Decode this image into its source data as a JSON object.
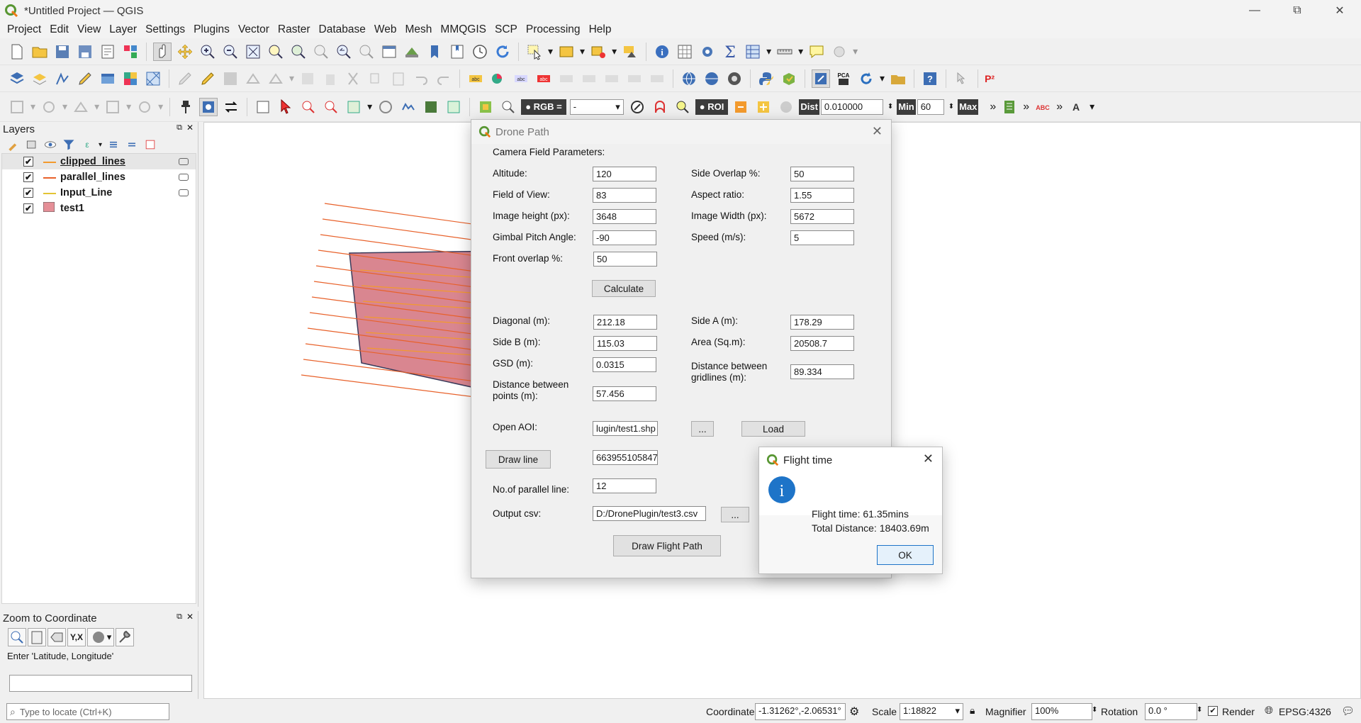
{
  "window": {
    "title": "*Untitled Project — QGIS"
  },
  "menu": [
    "Project",
    "Edit",
    "View",
    "Layer",
    "Settings",
    "Plugins",
    "Vector",
    "Raster",
    "Database",
    "Web",
    "Mesh",
    "MMQGIS",
    "SCP",
    "Processing",
    "Help"
  ],
  "toolbar3": {
    "rgb_label": "RGB =",
    "rgb_value": "-",
    "roi_label": "ROI",
    "dist_label": "Dist",
    "dist_value": "0.010000",
    "min_label": "Min",
    "min_value": "60",
    "max_label": "Max",
    "more": "»",
    "p2": "P²"
  },
  "layers_panel": {
    "title": "Layers",
    "layers": [
      {
        "name": "clipped_lines",
        "checked": true,
        "color": "#f39a2d"
      },
      {
        "name": "parallel_lines",
        "checked": true,
        "color": "#e8612a"
      },
      {
        "name": "Input_Line",
        "checked": true,
        "color": "#e3c434"
      },
      {
        "name": "test1",
        "checked": true,
        "color": "#e58f97"
      }
    ]
  },
  "zoom_panel": {
    "title": "Zoom to Coordinate",
    "prompt": "Enter 'Latitude, Longitude'",
    "input_value": "",
    "yx_label": "Y,X"
  },
  "status": {
    "locate_placeholder": "Type to locate (Ctrl+K)",
    "coordinate_label": "Coordinate",
    "coordinate_value": "-1.31262°,-2.06531°",
    "scale_label": "Scale",
    "scale_value": "1:18822",
    "magnifier_label": "Magnifier",
    "magnifier_value": "100%",
    "rotation_label": "Rotation",
    "rotation_value": "0.0 °",
    "render_label": "Render",
    "crs": "EPSG:4326"
  },
  "drone_dialog": {
    "title": "Drone Path",
    "section": "Camera Field Parameters:",
    "fields": {
      "altitude": {
        "label": "Altitude:",
        "value": "120"
      },
      "side_overlap": {
        "label": "Side Overlap %:",
        "value": "50"
      },
      "fov": {
        "label": "Field of View:",
        "value": "83"
      },
      "aspect": {
        "label": "Aspect ratio:",
        "value": "1.55"
      },
      "img_h": {
        "label": "Image height (px):",
        "value": "3648"
      },
      "img_w": {
        "label": "Image Width (px):",
        "value": "5672"
      },
      "gimbal": {
        "label": "Gimbal Pitch Angle:",
        "value": "-90"
      },
      "speed": {
        "label": "Speed (m/s):",
        "value": "5"
      },
      "front_overlap": {
        "label": "Front overlap %:",
        "value": "50"
      },
      "diagonal": {
        "label": "Diagonal (m):",
        "value": "212.18"
      },
      "side_a": {
        "label": "Side A (m):",
        "value": "178.29"
      },
      "side_b": {
        "label": "Side B (m):",
        "value": "115.03"
      },
      "area": {
        "label": "Area (Sq.m):",
        "value": "20508.7"
      },
      "gsd": {
        "label": "GSD (m):",
        "value": "0.0315"
      },
      "grid_dist": {
        "label1": "Distance between",
        "label2": "gridlines (m):",
        "value": "89.334"
      },
      "pt_dist": {
        "label1": "Distance between",
        "label2": "points (m):",
        "value": "57.456"
      },
      "aoi": {
        "label": "Open AOI:",
        "value": "lugin/test1.shp"
      },
      "line_value": "663955105847",
      "parallel": {
        "label": "No.of parallel line:",
        "value": "12"
      },
      "output": {
        "label": "Output csv:",
        "value": "D:/DronePlugin/test3.csv"
      }
    },
    "buttons": {
      "calculate": "Calculate",
      "browse": "...",
      "load": "Load",
      "draw_line": "Draw line",
      "draw_path": "Draw Flight Path"
    }
  },
  "flight_dialog": {
    "title": "Flight time",
    "line1": "Flight time: 61.35mins",
    "line2": "Total Distance: 18403.69m",
    "ok": "OK"
  }
}
